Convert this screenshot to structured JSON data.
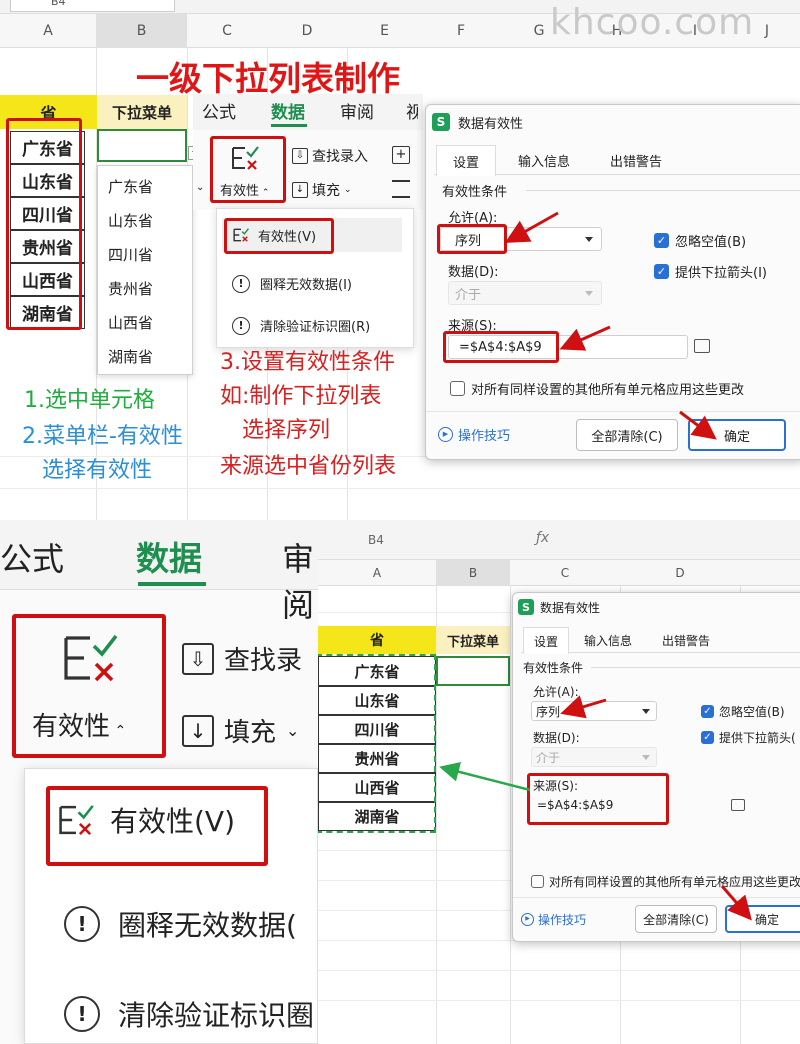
{
  "watermark": "khcoo.com",
  "top_bar": {
    "cell_ref": "B4"
  },
  "columns_top": [
    "A",
    "B",
    "C",
    "D",
    "E",
    "F",
    "G",
    "H",
    "I",
    "J"
  ],
  "title": "一级下拉列表制作",
  "table": {
    "header_a": "省",
    "header_b": "下拉菜单",
    "provinces": [
      "广东省",
      "山东省",
      "四川省",
      "贵州省",
      "山西省",
      "湖南省"
    ]
  },
  "dropdown_options": [
    "广东省",
    "山东省",
    "四川省",
    "贵州省",
    "山西省",
    "湖南省"
  ],
  "ribbon": {
    "tab_formula": "公式",
    "tab_data": "数据",
    "tab_review": "审阅",
    "tab_partial": "视",
    "validity_label": "有效性",
    "find_entry": "查找录入",
    "fill": "填充",
    "find_entry_cut": "查找录"
  },
  "validity_menu": {
    "item1": "有效性(V)",
    "item2": "圈释无效数据(I)",
    "item2_cut": "圈释无效数据(",
    "item3": "清除验证标识圈(R)",
    "item3_cut": "清除验证标识圈"
  },
  "steps": {
    "s1": "1.选中单元格",
    "s2a": "2.菜单栏-有效性",
    "s2b": "选择有效性",
    "s3a": "3.设置有效性条件",
    "s3b": "如:制作下拉列表",
    "s3c": "选择序列",
    "s3d": "来源选中省份列表"
  },
  "dialog": {
    "title": "数据有效性",
    "logo": "S",
    "tabs": [
      "设置",
      "输入信息",
      "出错警告"
    ],
    "section": "有效性条件",
    "allow_label": "允许(A):",
    "allow_value": "序列",
    "data_label": "数据(D):",
    "data_value": "介于",
    "ignore_blank": "忽略空值(B)",
    "dropdown_arrow": "提供下拉箭头(I)",
    "dropdown_arrow_cut": "提供下拉箭头(",
    "source_label": "来源(S):",
    "source_value": "=$A$4:$A$9",
    "apply_all": "对所有同样设置的其他所有单元格应用这些更改",
    "apply_all_cut": "对所有同样设置的其他所有单元格应用这些更改",
    "tips": "操作技巧",
    "clear_all": "全部清除(C)",
    "ok": "确定"
  },
  "bottom_right_bar": {
    "cell_ref": "B4",
    "fx": "ƒx"
  },
  "columns_bottom": [
    "A",
    "B",
    "C",
    "D"
  ],
  "colors": {
    "red": "#d01010",
    "green": "#1e8f4e",
    "blue": "#2a7fd4",
    "yellow": "#f5e61a",
    "accent_blue": "#2a6fd6"
  }
}
